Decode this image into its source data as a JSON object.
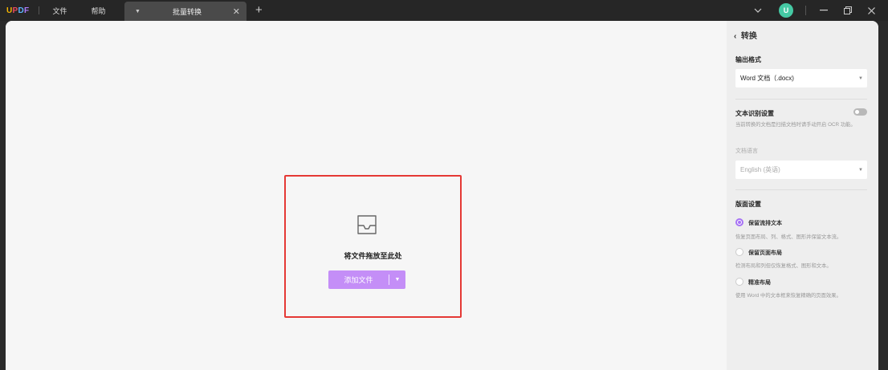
{
  "titlebar": {
    "logo": {
      "u": "U",
      "p": "P",
      "d": "D",
      "f": "F"
    },
    "menu": [
      {
        "label": "文件"
      },
      {
        "label": "帮助"
      }
    ],
    "tab": {
      "title": "批量转换"
    },
    "avatar_letter": "U",
    "icons": {
      "dropdown": "chevron-down-icon",
      "minimize": "minimize-icon",
      "restore": "restore-icon",
      "close": "close-icon",
      "tab_add": "plus-icon",
      "tab_close": "close-icon"
    }
  },
  "drop_zone": {
    "text": "将文件拖放至此处",
    "add_button": "添加文件",
    "icon": "inbox-tray-icon",
    "highlight_color": "#e53935",
    "button_color": "#c48ef7"
  },
  "panel": {
    "title": "转换",
    "output_format": {
      "label": "输出格式",
      "value": "Word 文档（.docx)"
    },
    "ocr": {
      "label": "文本识别设置",
      "enabled": false,
      "description": "当前转换的文档是扫描文档时请手动开启 OCR 功能。",
      "language_label": "文档语言",
      "language_value": "English (英语)"
    },
    "layout": {
      "label": "版面设置",
      "options": [
        {
          "label": "保留流排文本",
          "desc": "恢复页面布局、列、格式、图形并保留文本流。",
          "checked": true
        },
        {
          "label": "保留页面布局",
          "desc": "检测布局和列但仅恢复格式、图形和文本。",
          "checked": false
        },
        {
          "label": "精准布局",
          "desc": "使用 Word 中的文本框来恢复精确的页面效果。",
          "checked": false
        }
      ]
    },
    "accent_color": "#a773f5"
  }
}
